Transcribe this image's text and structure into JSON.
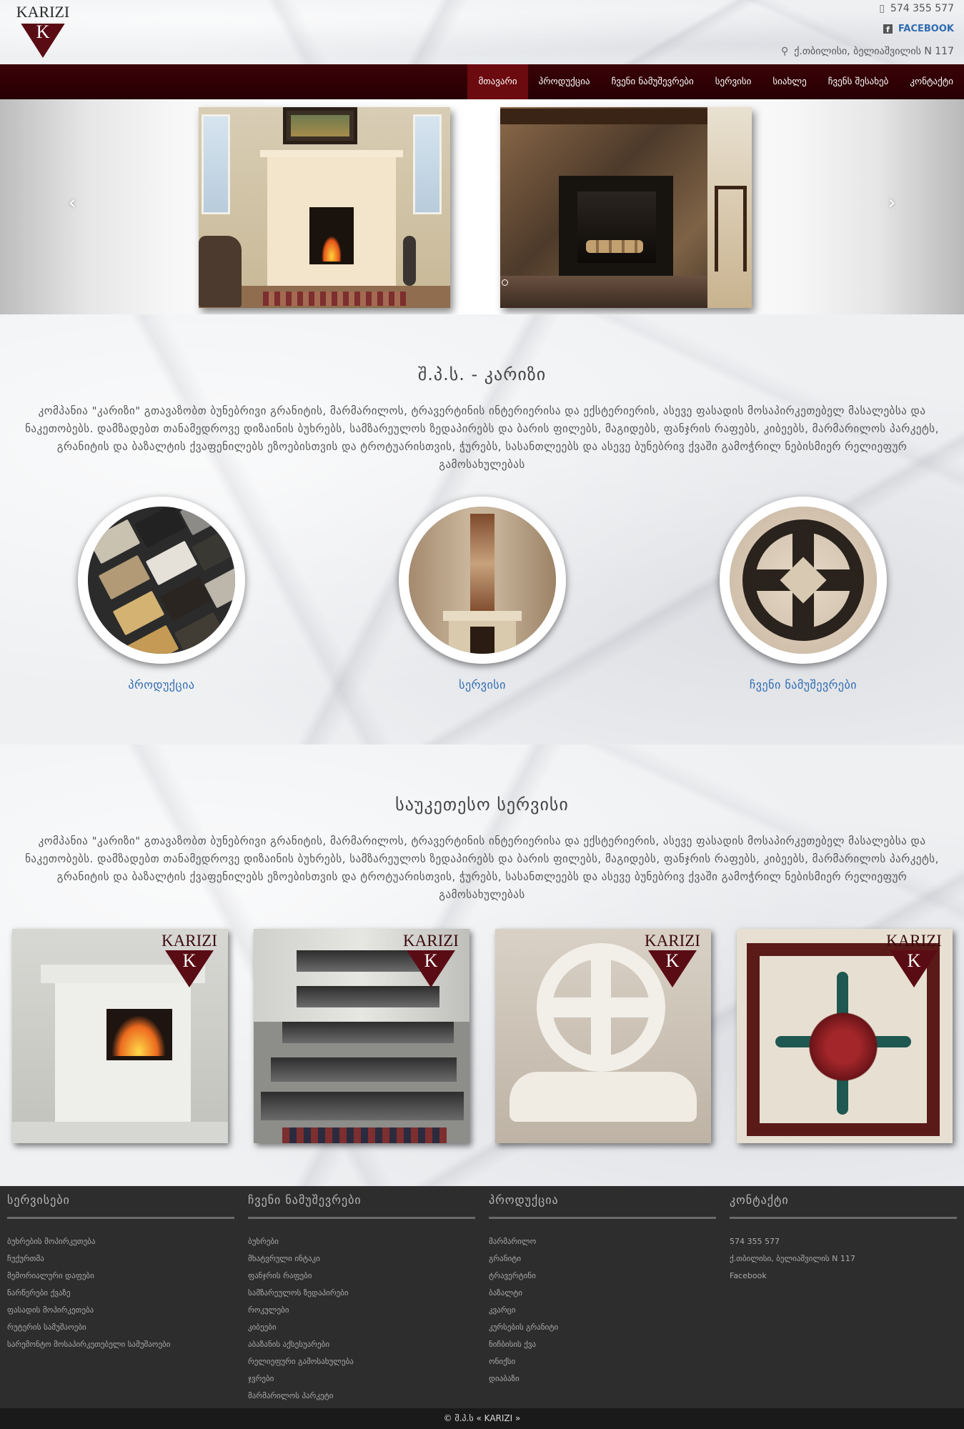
{
  "header": {
    "logo_text": "KARIZI",
    "logo_letter": "K",
    "phone": "574 355 577",
    "facebook": "FACEBOOK",
    "address": "ქ.თბილისი, ბელიაშვილის N 117"
  },
  "nav": {
    "items": [
      {
        "label": "მთავარი",
        "active": true
      },
      {
        "label": "პროდუქცია"
      },
      {
        "label": "ჩვენი ნამუშევრები"
      },
      {
        "label": "სერვისი"
      },
      {
        "label": "სიახლე"
      },
      {
        "label": "ჩვენს შესახებ"
      },
      {
        "label": "კონტაქტი"
      }
    ]
  },
  "slider": {
    "prev_icon": "chevron-left-icon",
    "next_icon": "chevron-right-icon"
  },
  "about": {
    "title": "შ.პ.ს. - კარიზი",
    "text": "კომპანია \"კარიზი\" გთავაზობთ ბუნებრივი გრანიტის, მარმარილოს, ტრავერტინის ინტერიერისა და ექსტერიერის, ასევე ფასადის მოსაპირკეთებელ მასალებსა და ნაკეთობებს. დამზადებთ თანამედროვე დიზაინის ბუხრებს, სამზარეულოს ზედაპირებს და ბარის ფილებს, მაგიდებს, ფანჯრის რაფებს, კიბეებს, მარმარილოს პარკეტს, გრანიტის და ბაზალტის ქვაფენილებს ეზოებისთვის და ტროტუარისთვის, ჭურებს, სასანთლეებს და ასევე ბუნებრივ ქვაში გამოჭრილ ნებისმიერ რელიეფურ გამოსახულებას",
    "circles": [
      {
        "label": "პროდუქცია"
      },
      {
        "label": "სერვისი"
      },
      {
        "label": "ჩვენი ნამუშევრები"
      }
    ]
  },
  "service": {
    "title": "საუკეთესო სერვისი",
    "text": "კომპანია \"კარიზი\" გთავაზობთ ბუნებრივი გრანიტის, მარმარილოს, ტრავერტინის ინტერიერისა და ექსტერიერის, ასევე ფასადის მოსაპირკეთებელ მასალებსა და ნაკეთობებს. დამზადებთ თანამედროვე დიზაინის ბუხრებს, სამზარეულოს ზედაპირებს და ბარის ფილებს, მაგიდებს, ფანჯრის რაფებს, კიბეებს, მარმარილოს პარკეტს, გრანიტის და ბაზალტის ქვაფენილებს ეზოებისთვის და ტროტუარისთვის, ჭურებს, სასანთლეებს და ასევე ბუნებრივ ქვაში გამოჭრილ ნებისმიერ რელიეფურ გამოსახულებას",
    "watermark": "KARIZI"
  },
  "footer": {
    "columns": [
      {
        "title": "სერვისები",
        "items": [
          "ბუხრების მოპირკეთება",
          "ჩუქურთმა",
          "მემორიალური დაფები",
          "ნარწერები ქვაზე",
          "ფასადის მოპირკეთება",
          "რუტერის სამუშაოები",
          "სარემონტო მოსაპირკეთებელი სამუშაოები"
        ]
      },
      {
        "title": "ჩვენი ნამუშევრები",
        "items": [
          "ბუხრები",
          "მხატვრული ინტაკი",
          "ფანჯრის რაფები",
          "სამზარეულოს ზედაპირები",
          "როკულები",
          "კიბეები",
          "აბაზანის აქსესუარები",
          "რელიეფური გამოსახულება",
          "ჯვრები",
          "მარმარილოს პარკეტი"
        ]
      },
      {
        "title": "პროდუქცია",
        "items": [
          "მარმარილო",
          "გრანიტი",
          "ტრავერტინი",
          "ბაზალტი",
          "კვარცი",
          "კურსების გრანიტი",
          "ნიჩბისის ქვა",
          "ონიქსი",
          "დიაბაზი"
        ]
      },
      {
        "title": "კონტაქტი",
        "items": [
          "574 355 577",
          "ქ.თბილისი, ბელიაშვილის N 117",
          "Facebook"
        ]
      }
    ],
    "copyright": "© შ.პ.ს « KARIZI »"
  }
}
